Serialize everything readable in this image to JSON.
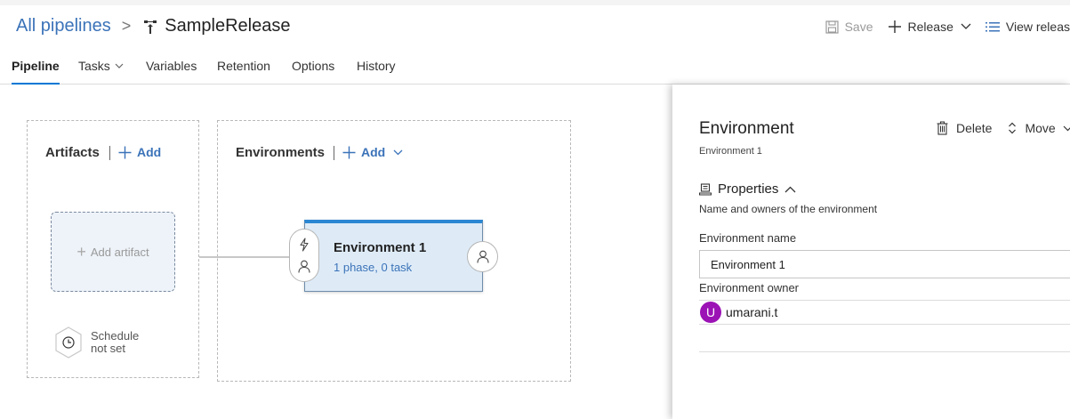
{
  "header": {
    "breadcrumb_root": "All pipelines",
    "separator": ">",
    "pipeline_name": "SampleRelease",
    "actions": {
      "save": "Save",
      "release": "Release",
      "view_releases": "View releas"
    }
  },
  "tabs": [
    {
      "label": "Pipeline",
      "active": true
    },
    {
      "label": "Tasks",
      "has_dropdown": true
    },
    {
      "label": "Variables"
    },
    {
      "label": "Retention"
    },
    {
      "label": "Options"
    },
    {
      "label": "History"
    }
  ],
  "canvas": {
    "artifacts": {
      "title": "Artifacts",
      "add_label": "Add",
      "placeholder": "Add artifact",
      "schedule_line1": "Schedule",
      "schedule_line2": "not set"
    },
    "environments": {
      "title": "Environments",
      "add_label": "Add",
      "card": {
        "name": "Environment 1",
        "summary": "1 phase, 0 task"
      }
    }
  },
  "panel": {
    "title": "Environment",
    "subtitle": "Environment 1",
    "actions": {
      "delete": "Delete",
      "move": "Move"
    },
    "section_title": "Properties",
    "section_desc": "Name and owners of the environment",
    "env_name_label": "Environment name",
    "env_name_value": "Environment 1",
    "owner_label": "Environment owner",
    "owner_initial": "U",
    "owner_name": "umarani.t",
    "avatar_color": "#9b12b5"
  },
  "colors": {
    "link": "#3b73b9",
    "accent": "#0078d4",
    "card_bg": "#deebf7",
    "card_top": "#2b87d3"
  }
}
